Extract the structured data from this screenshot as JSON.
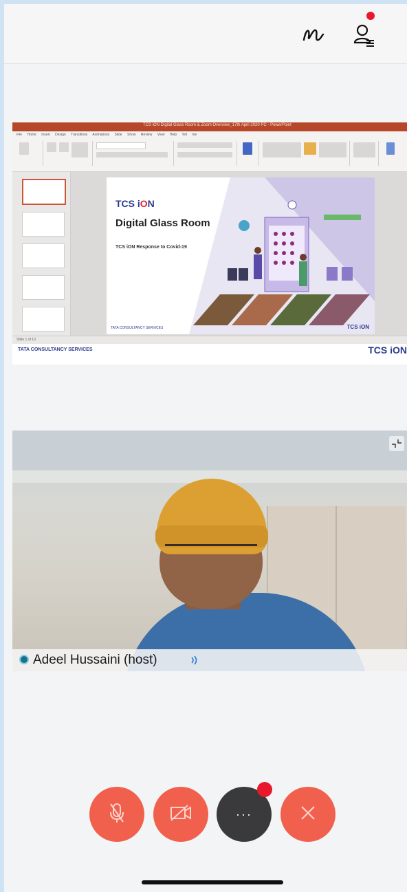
{
  "top_bar": {
    "annotate_icon": "scribble-pen-icon",
    "participants_icon": "participants-list-icon",
    "participants_badge_color": "#e8192c"
  },
  "shared_screen": {
    "app_title": "TCS iON Digital Glass Room & Zoom Overview_17th April 2020 PC - PowerPoint",
    "ribbon_tabs": [
      "File",
      "Home",
      "Insert",
      "Design",
      "Transitions",
      "Animations",
      "Slide Show",
      "Review",
      "View",
      "Help",
      "Tell me"
    ],
    "slide": {
      "logo_main": "TCS i",
      "logo_accent": "O",
      "logo_end": "N",
      "title": "Digital Glass Room",
      "subtitle": "TCS iON Response to Covid-19",
      "corner_brand": "TCS iON",
      "footer_brand": "TATA CONSULTANCY SERVICES"
    },
    "status_text": "Slide 1 of 10",
    "footer_left": "TATA CONSULTANCY SERVICES",
    "footer_right": "TCS iON"
  },
  "video": {
    "participant_name": "Adeel Hussaini (host)",
    "speaking_icon": "speaking-icon",
    "expand_icon": "collapse-expand-icon"
  },
  "controls": {
    "mic": {
      "icon": "mic-muted-icon",
      "color": "#f0604d"
    },
    "camera": {
      "icon": "video-off-icon",
      "color": "#f0604d"
    },
    "more": {
      "label": "···",
      "icon": "more-options-icon",
      "color": "#3a3a3c",
      "badge_color": "#e8192c"
    },
    "leave": {
      "icon": "close-icon",
      "color": "#f0604d"
    }
  }
}
